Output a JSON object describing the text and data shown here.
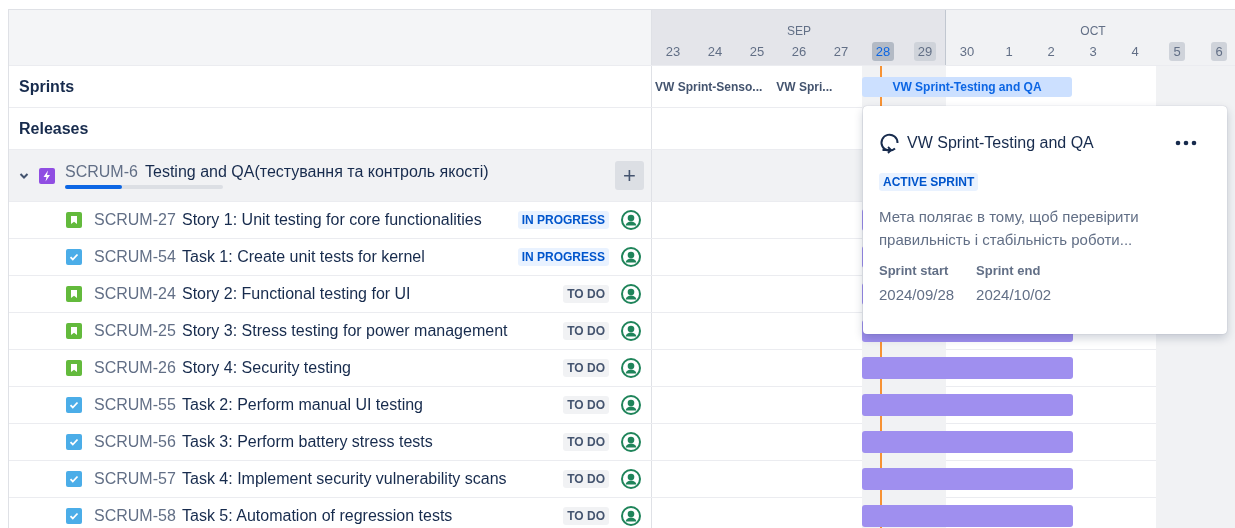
{
  "timeline": {
    "months": [
      {
        "label": "SEP",
        "current": true
      },
      {
        "label": "OCT",
        "current": false
      }
    ],
    "days": [
      {
        "label": "23",
        "kind": "day"
      },
      {
        "label": "24",
        "kind": "day"
      },
      {
        "label": "25",
        "kind": "day"
      },
      {
        "label": "26",
        "kind": "day"
      },
      {
        "label": "27",
        "kind": "day"
      },
      {
        "label": "28",
        "kind": "today"
      },
      {
        "label": "29",
        "kind": "weekend"
      },
      {
        "label": "30",
        "kind": "day"
      },
      {
        "label": "1",
        "kind": "day"
      },
      {
        "label": "2",
        "kind": "day"
      },
      {
        "label": "3",
        "kind": "day"
      },
      {
        "label": "4",
        "kind": "day"
      },
      {
        "label": "5",
        "kind": "weekend"
      },
      {
        "label": "6",
        "kind": "weekend"
      }
    ]
  },
  "sprints": {
    "label": "Sprints",
    "items": [
      {
        "label": "VW Sprint-Senso...",
        "active": false
      },
      {
        "label": "VW Spri...",
        "active": false
      },
      {
        "label": "VW Sprint-Testing and QA",
        "active": true
      }
    ]
  },
  "releases": {
    "label": "Releases"
  },
  "epic": {
    "key": "SCRUM-6",
    "title": "Testing and QA(тестування та контроль якості)",
    "expanded": true,
    "level": 0.36,
    "add_label": "+"
  },
  "issues": [
    {
      "kind": "story",
      "key": "SCRUM-27",
      "title": "Story 1: Unit testing for core functionalities",
      "status": {
        "label": "IN PROGRESS",
        "kind": "inprogress"
      }
    },
    {
      "kind": "task",
      "key": "SCRUM-54",
      "title": "Task 1: Create unit tests for kernel",
      "status": {
        "label": "IN PROGRESS",
        "kind": "inprogress"
      }
    },
    {
      "kind": "story",
      "key": "SCRUM-24",
      "title": "Story 2: Functional testing for UI",
      "status": {
        "label": "TO DO",
        "kind": "todo"
      }
    },
    {
      "kind": "story",
      "key": "SCRUM-25",
      "title": "Story 3: Stress testing for power management",
      "status": {
        "label": "TO DO",
        "kind": "todo"
      }
    },
    {
      "kind": "story",
      "key": "SCRUM-26",
      "title": "Story 4: Security testing",
      "status": {
        "label": "TO DO",
        "kind": "todo"
      }
    },
    {
      "kind": "task",
      "key": "SCRUM-55",
      "title": "Task 2: Perform manual UI testing",
      "status": {
        "label": "TO DO",
        "kind": "todo"
      }
    },
    {
      "kind": "task",
      "key": "SCRUM-56",
      "title": "Task 3: Perform battery stress tests",
      "status": {
        "label": "TO DO",
        "kind": "todo"
      }
    },
    {
      "kind": "task",
      "key": "SCRUM-57",
      "title": "Task 4: Implement security vulnerability scans",
      "status": {
        "label": "TO DO",
        "kind": "todo"
      }
    },
    {
      "kind": "task",
      "key": "SCRUM-58",
      "title": "Task 5: Automation of regression tests",
      "status": {
        "label": "TO DO",
        "kind": "todo"
      }
    }
  ],
  "popover": {
    "title": "VW Sprint-Testing and QA",
    "badge": "ACTIVE SPRINT",
    "description": "Мета полягає в тому, щоб перевірити правильність і стабільність роботи...",
    "fields": [
      {
        "label": "Sprint start",
        "value": "2024/09/28"
      },
      {
        "label": "Sprint end",
        "value": "2024/10/02"
      }
    ]
  }
}
